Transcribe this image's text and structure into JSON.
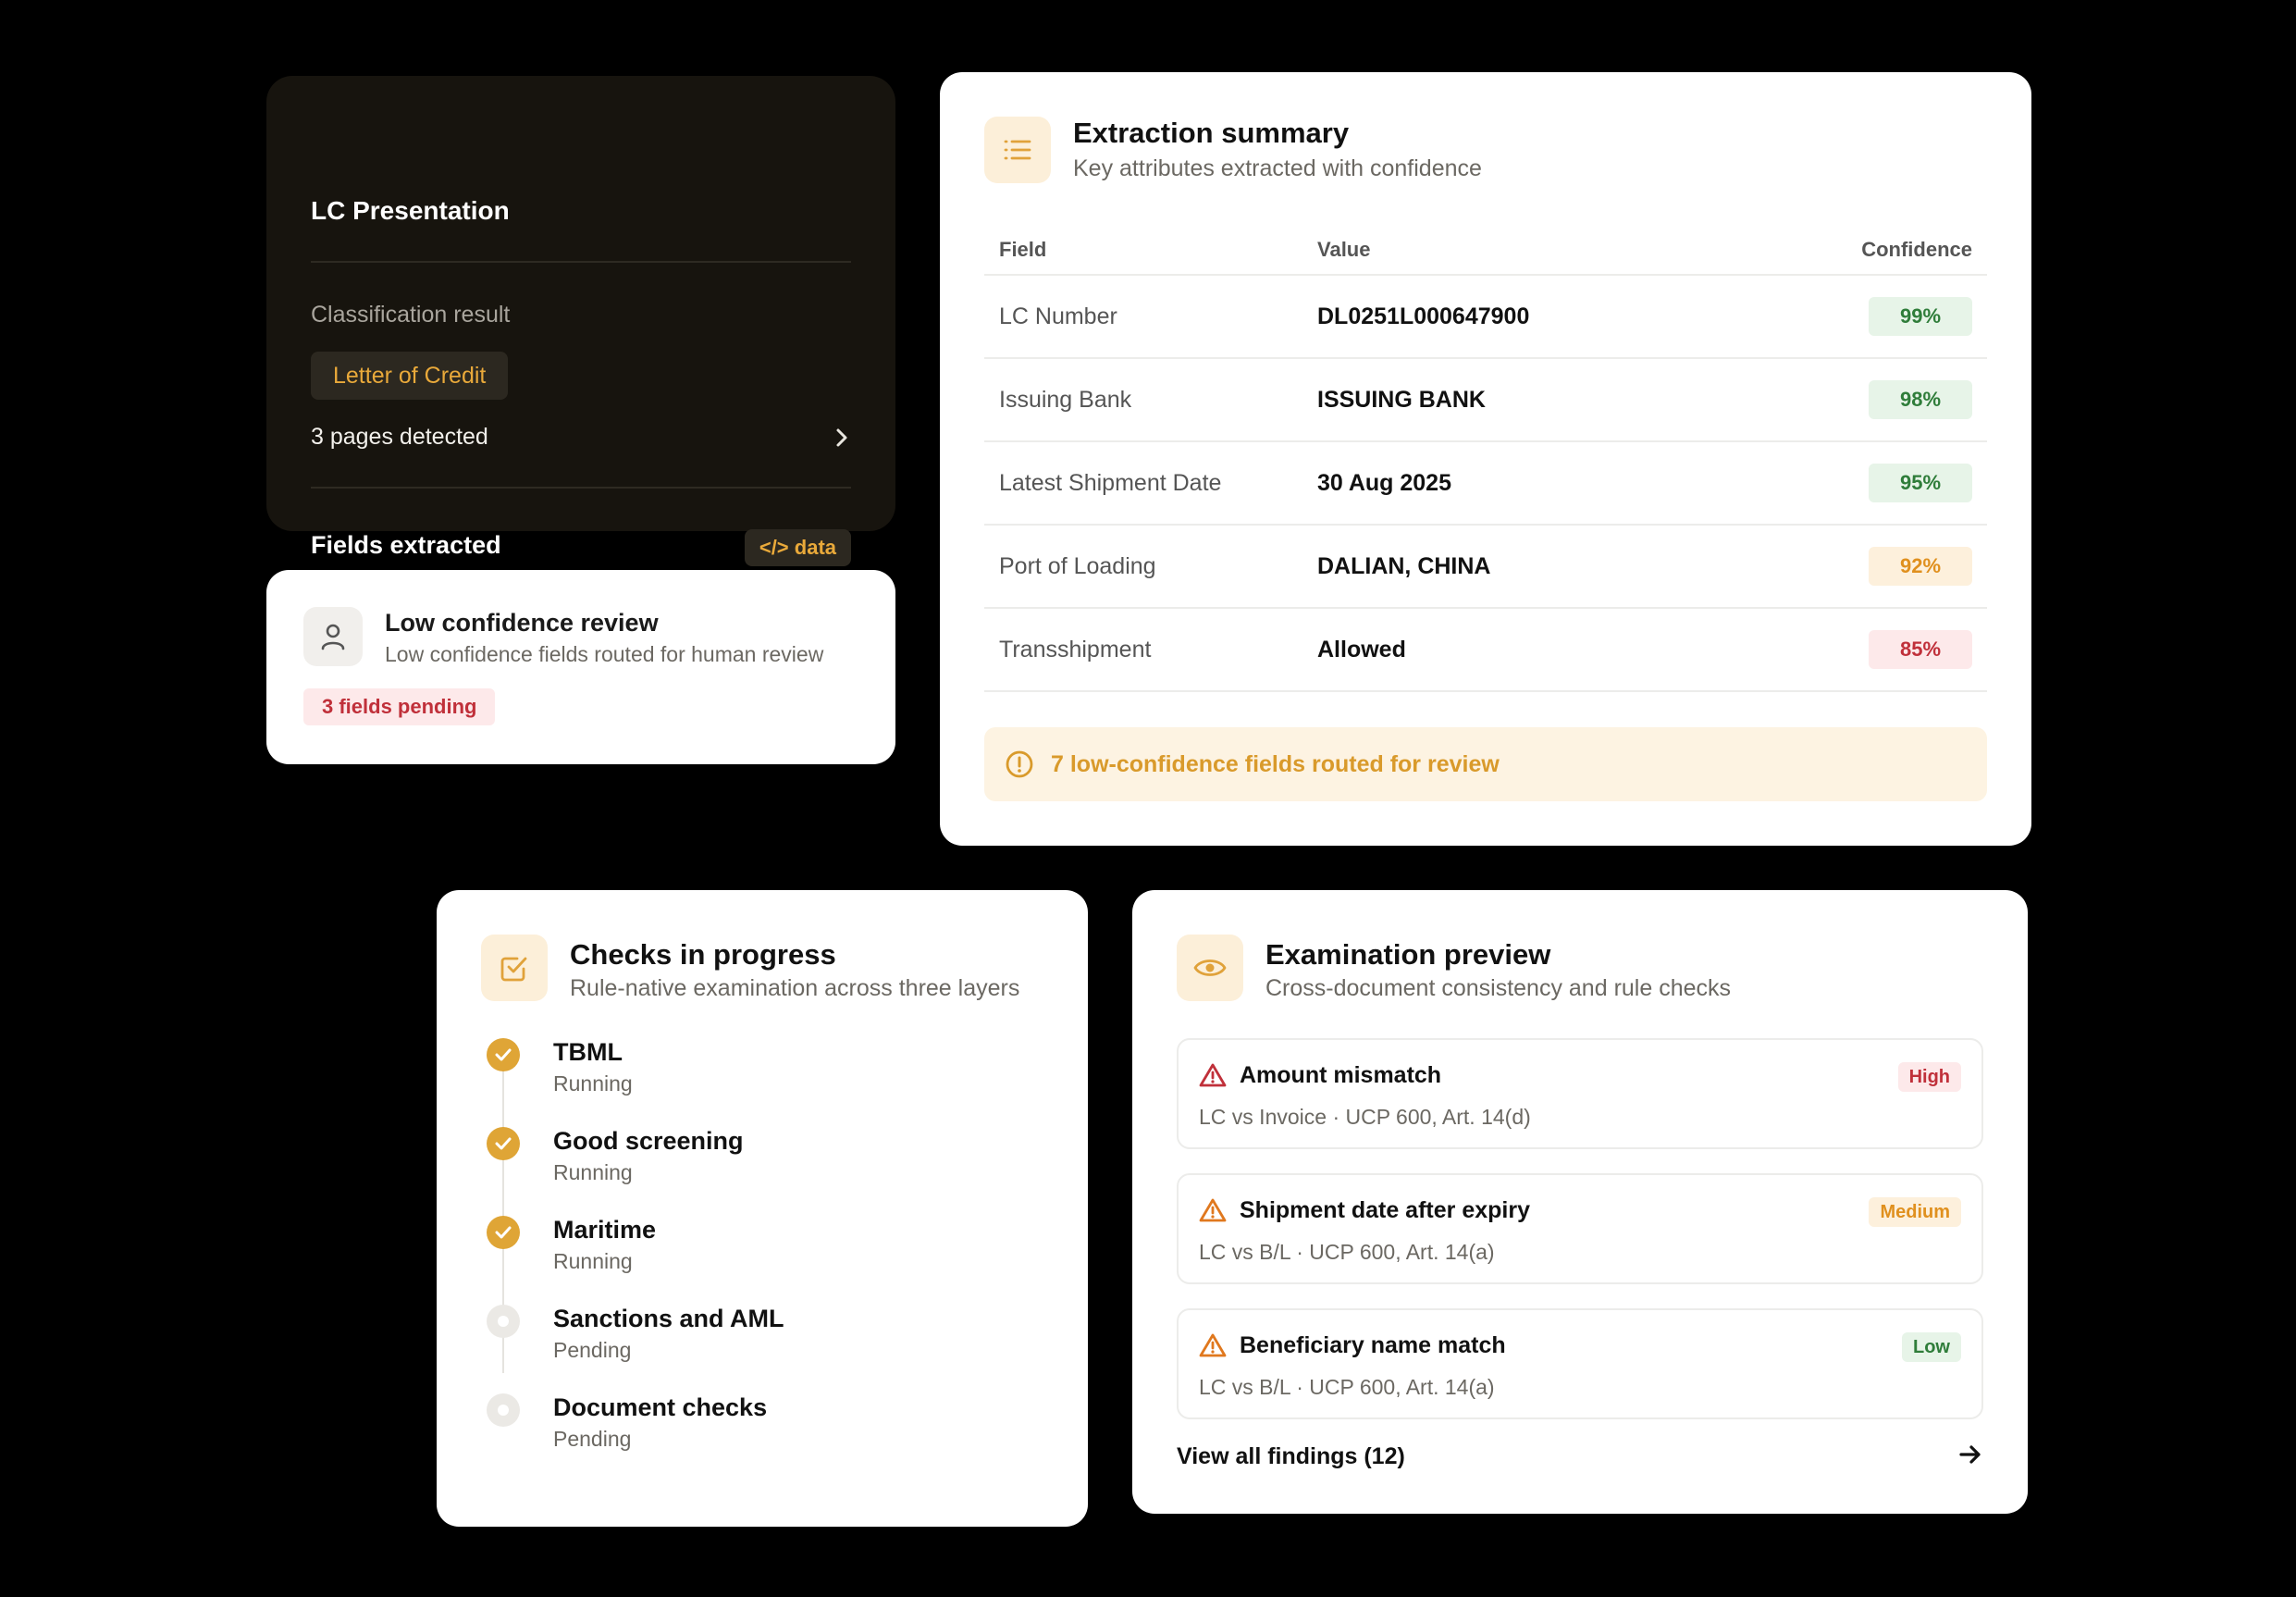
{
  "lc_card": {
    "title": "LC Presentation",
    "classification_label": "Classification result",
    "classification_value": "Letter of Credit",
    "pages_detected": "3 pages detected",
    "fields_extracted": "Fields extracted",
    "data_chip": "</> data"
  },
  "low_confidence": {
    "title": "Low confidence review",
    "subtitle": "Low confidence fields routed for human review",
    "pending_badge": "3 fields pending"
  },
  "extraction": {
    "title": "Extraction summary",
    "subtitle": "Key attributes extracted with confidence",
    "headers": {
      "field": "Field",
      "value": "Value",
      "confidence": "Confidence"
    },
    "rows": [
      {
        "field": "LC Number",
        "value": "DL0251L000647900",
        "confidence": "99%",
        "level": "green"
      },
      {
        "field": "Issuing Bank",
        "value": "ISSUING BANK",
        "confidence": "98%",
        "level": "green"
      },
      {
        "field": "Latest Shipment Date",
        "value": "30 Aug 2025",
        "confidence": "95%",
        "level": "green"
      },
      {
        "field": "Port of Loading",
        "value": "DALIAN, CHINA",
        "confidence": "92%",
        "level": "amber"
      },
      {
        "field": "Transshipment",
        "value": "Allowed",
        "confidence": "85%",
        "level": "red"
      }
    ],
    "notice": "7 low-confidence fields routed for review"
  },
  "checks": {
    "title": "Checks in progress",
    "subtitle": "Rule-native examination across three layers",
    "steps": [
      {
        "name": "TBML",
        "status": "Running",
        "done": true
      },
      {
        "name": "Good screening",
        "status": "Running",
        "done": true
      },
      {
        "name": "Maritime",
        "status": "Running",
        "done": true
      },
      {
        "name": "Sanctions and AML",
        "status": "Pending",
        "done": false
      },
      {
        "name": "Document checks",
        "status": "Pending",
        "done": false
      }
    ]
  },
  "examination": {
    "title": "Examination preview",
    "subtitle": "Cross-document consistency and rule checks",
    "findings": [
      {
        "title": "Amount mismatch",
        "detail": "LC vs Invoice · UCP 600, Art. 14(d)",
        "severity": "High",
        "sev_class": "high",
        "icon_color": "#c0303a"
      },
      {
        "title": "Shipment date after expiry",
        "detail": "LC vs B/L · UCP 600, Art. 14(a)",
        "severity": "Medium",
        "sev_class": "medium",
        "icon_color": "#e0781e"
      },
      {
        "title": "Beneficiary name match",
        "detail": "LC vs B/L · UCP 600, Art. 14(a)",
        "severity": "Low",
        "sev_class": "low",
        "icon_color": "#e0781e"
      }
    ],
    "view_all": "View all findings (12)"
  },
  "colors": {
    "accent": "#dfa536",
    "background": "#000000",
    "dark_card": "#17140e"
  }
}
